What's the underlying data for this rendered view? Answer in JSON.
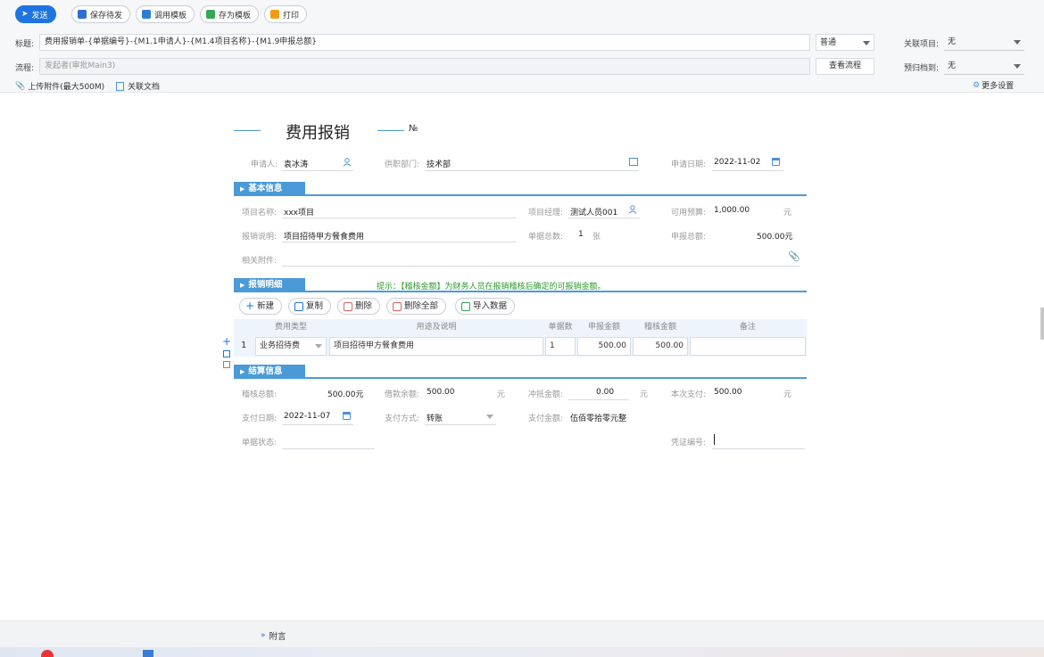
{
  "toolbar": {
    "send": "发送",
    "save_pending": "保存待发",
    "use_template": "调用模板",
    "save_template": "存为模板",
    "print": "打印"
  },
  "header": {
    "title_label": "标题:",
    "title_value": "费用报销单-{单据编号}-{M1.1申请人}-{M1.4项目名称}-{M1.9申报总额}",
    "priority": "普通",
    "related_project_label": "关联项目:",
    "related_project_value": "无",
    "flow_label": "流程:",
    "flow_placeholder": "发起者(审批Main3)",
    "view_flow": "查看流程",
    "archive_label": "预归档到:",
    "archive_value": "无",
    "upload": "上传附件(最大500M)",
    "related_doc": "关联文档",
    "more_settings": "更多设置"
  },
  "form": {
    "title": "费用报销",
    "no_label": "№",
    "applicant_label": "申请人:",
    "applicant": "袁冰涛",
    "dept_label": "供职部门:",
    "dept": "技术部",
    "date_label": "申请日期:",
    "date": "2022-11-02",
    "basic": {
      "title": "基本信息",
      "project_name_label": "项目名称:",
      "project_name": "xxx项目",
      "manager_label": "项目经理:",
      "manager": "测试人员001",
      "budget_label": "可用预算:",
      "budget": "1,000.00",
      "budget_unit": "元",
      "desc_label": "报销说明:",
      "desc": "项目招待甲方餐食费用",
      "count_label": "单据总数:",
      "count": "1",
      "count_unit": "张",
      "total_label": "申报总额:",
      "total": "500.00元",
      "attach_label": "相关附件:"
    },
    "detail": {
      "title": "报销明细",
      "hint": "提示：【稽核金额】为财务人员在报销稽核后确定的可报销金额。",
      "buttons": {
        "new": "新建",
        "copy": "复制",
        "delete": "删除",
        "delete_all": "删除全部",
        "import": "导入数据"
      },
      "columns": [
        "费用类型",
        "用途及说明",
        "单据数",
        "申报金额",
        "稽核金额",
        "备注"
      ],
      "rows": [
        {
          "index": "1",
          "type": "业务招待费",
          "purpose": "项目招待甲方餐食费用",
          "count": "1",
          "amount": "500.00",
          "audit": "500.00",
          "remark": ""
        }
      ]
    },
    "settle": {
      "title": "结算信息",
      "audit_total_label": "稽核总额:",
      "audit_total": "500.00元",
      "loan_label": "借款余额:",
      "loan": "500.00",
      "loan_unit": "元",
      "offset_label": "冲抵金额:",
      "offset": "0.00",
      "offset_unit": "元",
      "pay_label": "本次支付:",
      "pay": "500.00",
      "pay_unit": "元",
      "pay_date_label": "支付日期:",
      "pay_date": "2022-11-07",
      "pay_method_label": "支付方式:",
      "pay_method": "转账",
      "pay_amount_label": "支付金额:",
      "pay_amount": "伍佰零拾零元整",
      "status_label": "单据状态:",
      "voucher_label": "凭证编号:"
    }
  },
  "footer": {
    "note": "附言"
  },
  "colors": {
    "primary": "#1e74e0",
    "section": "#4a9ad8",
    "hint": "#2b9a2b"
  }
}
